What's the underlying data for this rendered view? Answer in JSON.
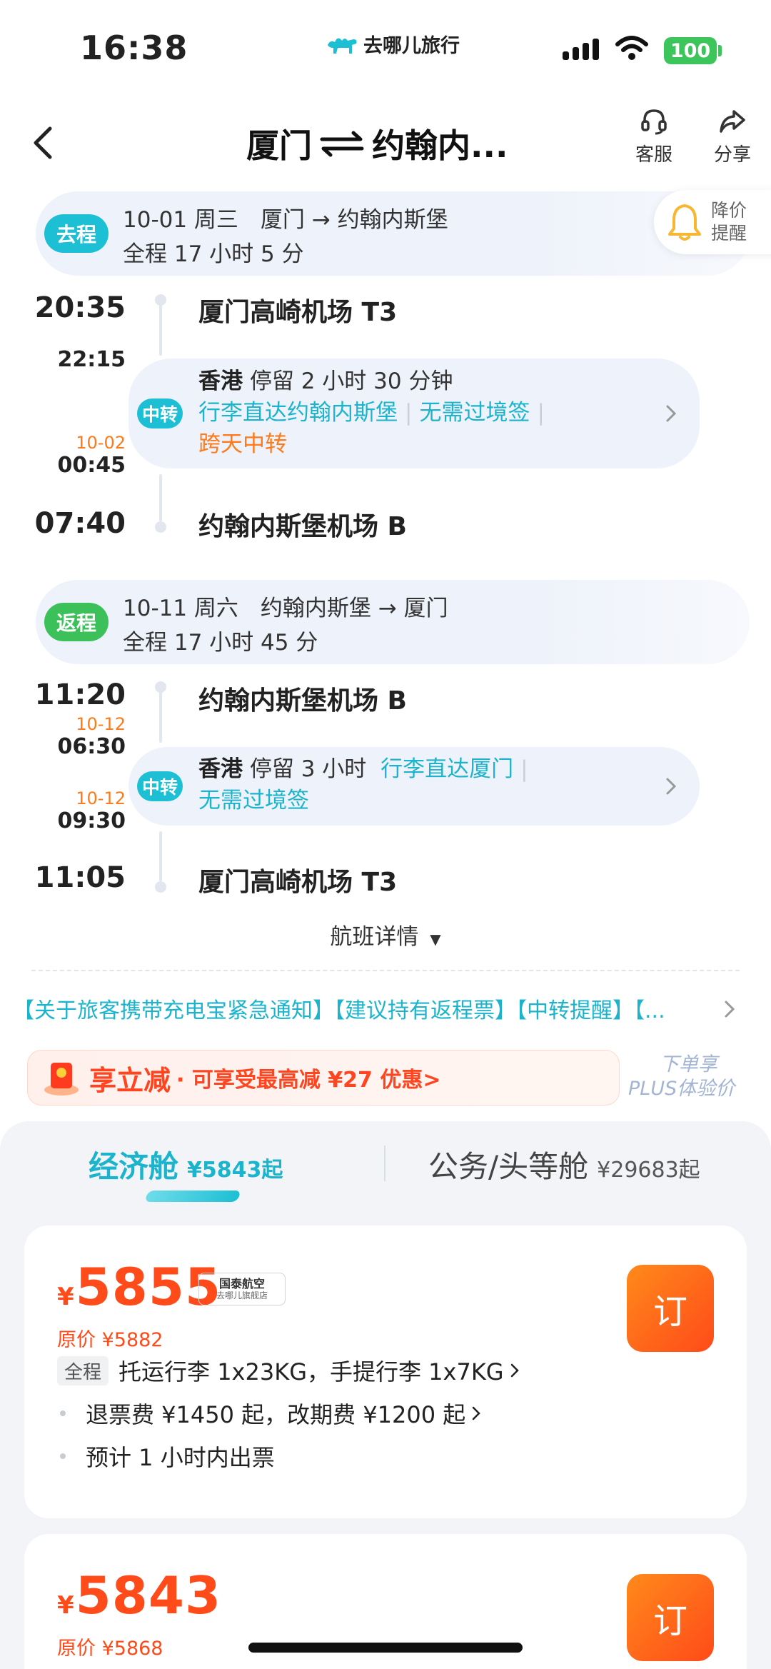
{
  "status_bar": {
    "time": "16:38",
    "battery": "100"
  },
  "brand": {
    "name": "去哪儿旅行"
  },
  "nav": {
    "from": "厦门",
    "to": "约翰内...",
    "service_label": "客服",
    "share_label": "分享"
  },
  "price_alert": {
    "line1": "降价",
    "line2": "提醒"
  },
  "outbound": {
    "badge": "去程",
    "line1": "10-01 周三　厦门 → 约翰内斯堡",
    "line2": "全程 17 小时 5 分",
    "depart_time": "20:35",
    "depart_airport": "厦门高崎机场 T3",
    "transfer_arrive": "22:15",
    "transfer_depart_date": "10-02",
    "transfer_depart": "00:45",
    "transfer_badge": "中转",
    "transfer_city": "香港",
    "transfer_stay": "停留 2 小时 30 分钟",
    "transfer_tags": [
      "行李直达约翰内斯堡",
      "无需过境签"
    ],
    "transfer_note": "跨天中转",
    "arrive_time": "07:40",
    "arrive_airport": "约翰内斯堡机场 B"
  },
  "return": {
    "badge": "返程",
    "line1": "10-11 周六　约翰内斯堡 → 厦门",
    "line2": "全程 17 小时 45 分",
    "depart_time": "11:20",
    "depart_airport": "约翰内斯堡机场 B",
    "transfer_arrive_date": "10-12",
    "transfer_arrive": "06:30",
    "transfer_depart_date": "10-12",
    "transfer_depart": "09:30",
    "transfer_badge": "中转",
    "transfer_city": "香港",
    "transfer_stay": "停留 3 小时",
    "transfer_tags": [
      "行李直达厦门",
      "无需过境签"
    ],
    "arrive_time": "11:05",
    "arrive_airport": "厦门高崎机场 T3"
  },
  "details_link": "航班详情",
  "notice": "【关于旅客携带充电宝紧急通知】【建议持有返程票】【中转提醒】【...",
  "promo": {
    "title": "享立减",
    "desc": "· 可享受最高减 ¥27 优惠>"
  },
  "plus_hint": {
    "line1": "下单享",
    "line2": "PLUS体验价"
  },
  "cabins": [
    {
      "name": "经济舱",
      "price": "¥5843起"
    },
    {
      "name": "公务/头等舱",
      "price": "¥29683起"
    }
  ],
  "fares": [
    {
      "currency": "¥",
      "price": "5855",
      "original": "原价 ¥5882",
      "airline_line1": "国泰航空",
      "airline_line2": "去哪儿旗舰店",
      "book_label": "订",
      "scope_chip": "全程",
      "baggage": "托运行李 1x23KG，手提行李 1x7KG",
      "refund": "退票费 ¥1450 起，改期费 ¥1200 起",
      "ticketing": "预计 1 小时内出票"
    },
    {
      "currency": "¥",
      "price": "5843",
      "original": "原价 ¥5868",
      "book_label": "订"
    }
  ],
  "colors": {
    "accent": "#1cb4cc",
    "go_badge": "#1cbfd4",
    "return_badge": "#3cc05a",
    "price": "#ff4a1a",
    "orange": "#ff7a1a"
  }
}
